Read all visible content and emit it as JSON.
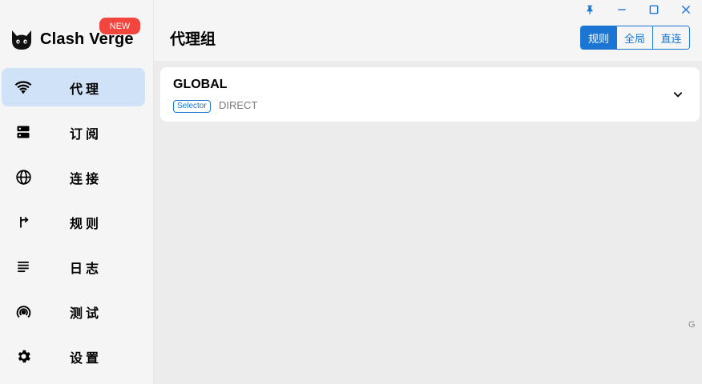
{
  "app": {
    "name": "Clash Verge",
    "badge": "NEW",
    "logo_icon": "cat-icon"
  },
  "sidebar": {
    "items": [
      {
        "label": "代理",
        "icon": "wifi-icon",
        "active": true
      },
      {
        "label": "订阅",
        "icon": "dns-icon",
        "active": false
      },
      {
        "label": "连接",
        "icon": "globe-icon",
        "active": false
      },
      {
        "label": "规则",
        "icon": "fork-arrow-icon",
        "active": false
      },
      {
        "label": "日志",
        "icon": "lines-icon",
        "active": false
      },
      {
        "label": "测试",
        "icon": "wifi-tethering-icon",
        "active": false
      },
      {
        "label": "设置",
        "icon": "gear-icon",
        "active": false
      }
    ]
  },
  "header": {
    "title": "代理组",
    "modes": [
      {
        "label": "规则",
        "active": true
      },
      {
        "label": "全局",
        "active": false
      },
      {
        "label": "直连",
        "active": false
      }
    ]
  },
  "window_controls": [
    "pin-icon",
    "minimize-icon",
    "maximize-icon",
    "close-icon"
  ],
  "groups": [
    {
      "name": "GLOBAL",
      "type": "Selector",
      "now": "DIRECT"
    }
  ],
  "alpha_index": [
    "G"
  ],
  "colors": {
    "accent": "#1a76d2",
    "active_nav_bg": "#cfe2f7",
    "badge": "#f2453d",
    "content_bg": "#ececec"
  }
}
